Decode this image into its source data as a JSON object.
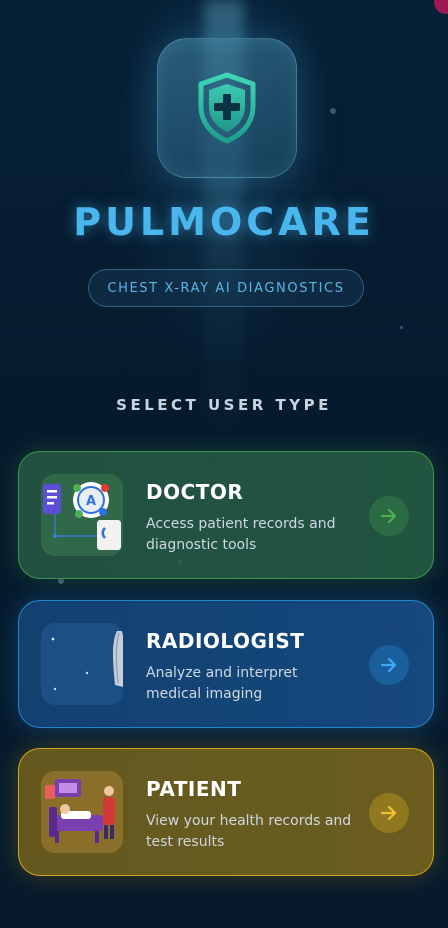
{
  "app": {
    "name": "PULMOCARE",
    "tagline": "CHEST X-RAY AI DIAGNOSTICS"
  },
  "select": {
    "title": "SELECT USER TYPE"
  },
  "roles": [
    {
      "title": "DOCTOR",
      "description": "Access patient records and diagnostic tools",
      "accent": "#4caf50",
      "icon": "doctor-illustration-icon"
    },
    {
      "title": "RADIOLOGIST",
      "description": "Analyze and interpret medical imaging",
      "accent": "#2996e6",
      "icon": "xray-illustration-icon"
    },
    {
      "title": "PATIENT",
      "description": "View your health records and test results",
      "accent": "#e6b91e",
      "icon": "patient-illustration-icon"
    }
  ],
  "colors": {
    "background": "#071a2e",
    "brand": "#49b6ee"
  }
}
